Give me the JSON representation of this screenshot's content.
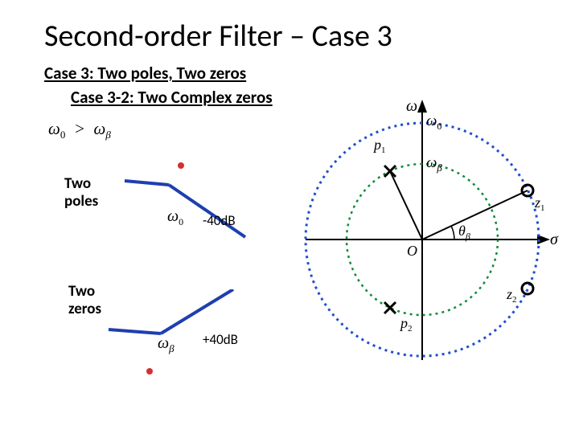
{
  "title": "Second-order Filter – Case 3",
  "subtitle1": "Case 3: Two poles, Two zeros",
  "subtitle2": "Case 3-2: Two Complex zeros",
  "inequality": "ω₀ > ω_β",
  "labels": {
    "two_poles": "Two\npoles",
    "two_zeros": "Two\nzeros",
    "db_poles": "-40dB",
    "db_zeros": "+40dB",
    "omega0": "ω₀",
    "omega_beta": "ω_β"
  },
  "pz": {
    "jw_axis": "ω",
    "sigma_axis": "σ",
    "origin": "O",
    "radius_outer_label": "ω₀",
    "radius_inner_label": "ω_β",
    "angle_label": "θ_β",
    "p1": "p₁",
    "p2": "p₂",
    "z1": "z₁",
    "z2": "z₂"
  },
  "chart_data": {
    "type": "diagram",
    "pole_zero_plot": {
      "outer_circle_radius": 1.0,
      "inner_circle_radius": 0.65,
      "poles": [
        {
          "label": "p₁",
          "angle_deg": 115,
          "radius": 0.65
        },
        {
          "label": "p₂",
          "angle_deg": -115,
          "radius": 0.65
        }
      ],
      "zeros": [
        {
          "label": "z₁",
          "angle_deg": 25,
          "radius": 1.0
        },
        {
          "label": "z₂",
          "angle_deg": -25,
          "radius": 1.0
        }
      ],
      "angle_marker": "θ_β"
    },
    "bode_sketches": [
      {
        "name": "two_poles",
        "corner": "ω₀",
        "slope_after": -40,
        "marker_position": "top"
      },
      {
        "name": "two_zeros",
        "corner": "ω_β",
        "slope_after": 40,
        "marker_position": "bottom"
      }
    ]
  }
}
